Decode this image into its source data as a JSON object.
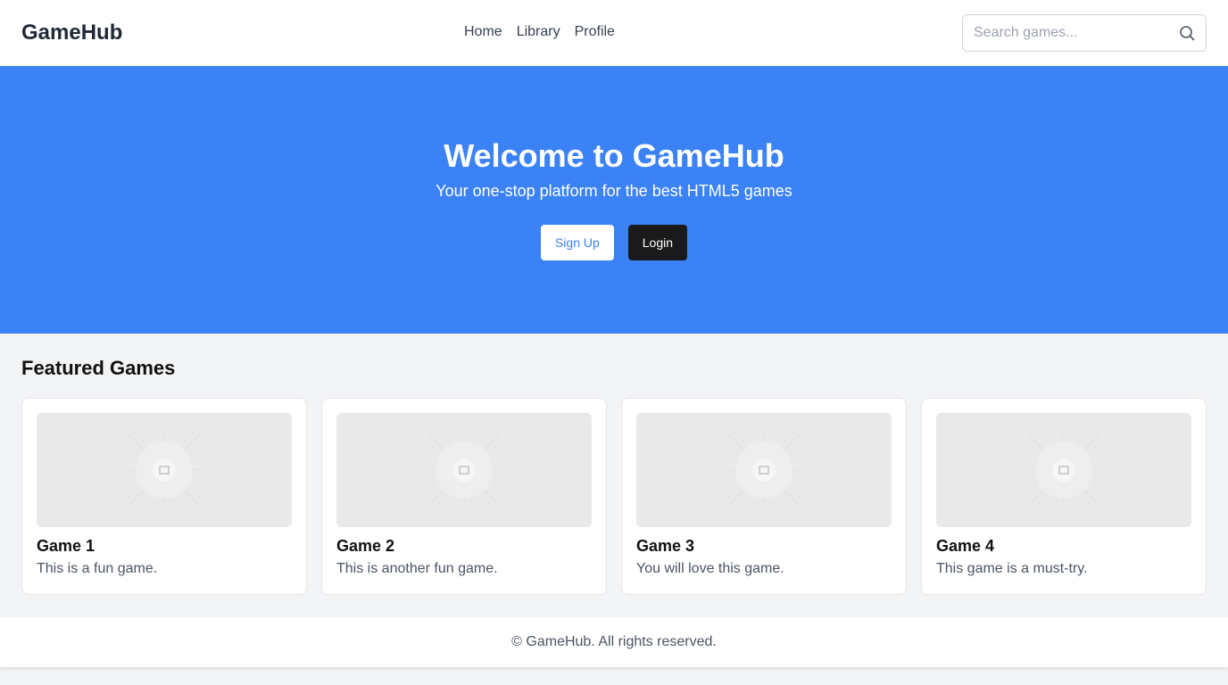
{
  "header": {
    "logo": "GameHub",
    "nav": [
      "Home",
      "Library",
      "Profile"
    ],
    "search_placeholder": "Search games..."
  },
  "hero": {
    "title": "Welcome to GameHub",
    "subtitle": "Your one-stop platform for the best HTML5 games",
    "signup": "Sign Up",
    "login": "Login",
    "color": "#3b82f6"
  },
  "featured": {
    "heading": "Featured Games",
    "games": [
      {
        "title": "Game 1",
        "desc": "This is a fun game."
      },
      {
        "title": "Game 2",
        "desc": "This is another fun game."
      },
      {
        "title": "Game 3",
        "desc": "You will love this game."
      },
      {
        "title": "Game 4",
        "desc": "This game is a must-try."
      }
    ]
  },
  "footer": {
    "text": "© GameHub. All rights reserved."
  }
}
